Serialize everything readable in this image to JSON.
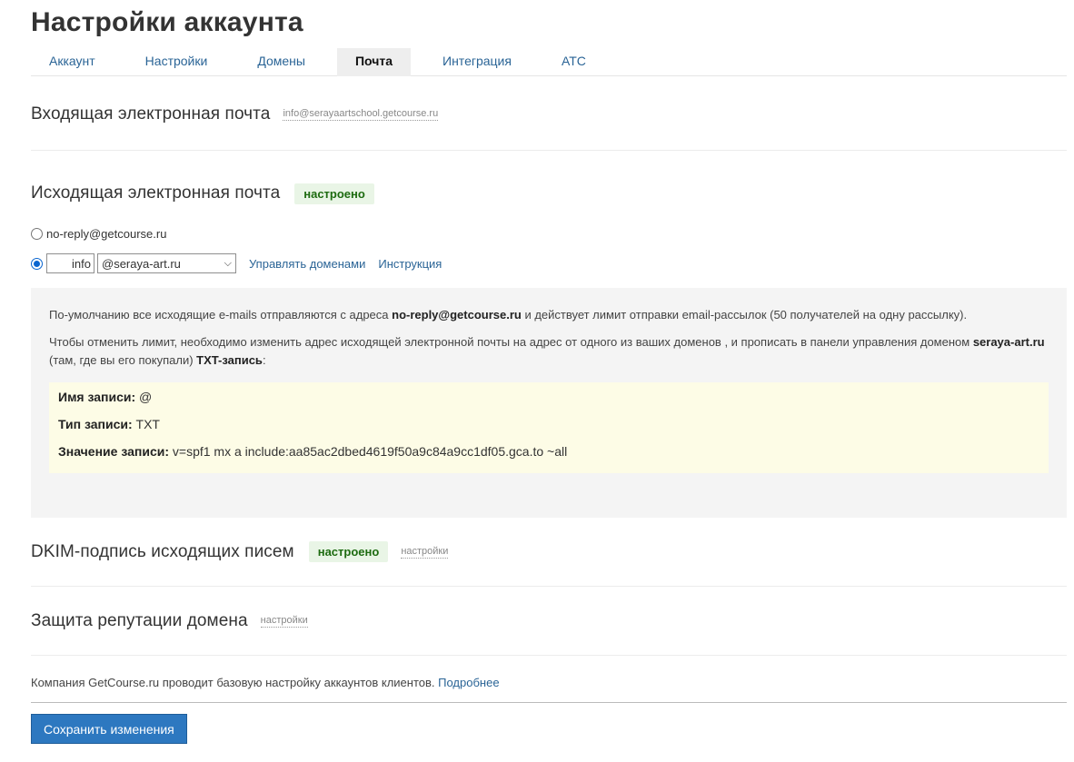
{
  "page": {
    "title": "Настройки аккаунта"
  },
  "tabs": [
    {
      "label": "Аккаунт"
    },
    {
      "label": "Настройки"
    },
    {
      "label": "Домены"
    },
    {
      "label": "Почта",
      "active": true
    },
    {
      "label": "Интеграция"
    },
    {
      "label": "АТС"
    }
  ],
  "incoming": {
    "title": "Входящая электронная почта",
    "address": "info@serayaartschool.getcourse.ru"
  },
  "outgoing": {
    "title": "Исходящая электронная почта",
    "status": "настроено",
    "option_default": "no-reply@getcourse.ru",
    "option_default_selected": false,
    "option_custom_selected": true,
    "local_part": "info",
    "domain_selected": "@seraya-art.ru",
    "manage_domains_link": "Управлять доменами",
    "instruction_link": "Инструкция"
  },
  "info": {
    "p1_a": "По-умолчанию все исходящие e-mails отправляются с адреса ",
    "p1_email": "no-reply@getcourse.ru",
    "p1_b": " и действует лимит отправки email-рассылок (50 получателей на одну рассылку).",
    "p2_a": "Чтобы отменить лимит, необходимо изменить адрес исходящей электронной почты на адрес от одного из ваших доменов   , и прописать в панели управления доменом ",
    "p2_domain": "seraya-art.ru",
    "p2_b": " (там, где вы его покупали) ",
    "p2_txt": "TXT-запись",
    "p2_c": ":",
    "record_name_label": "Имя записи:",
    "record_name_value": "@",
    "record_type_label": "Тип записи:",
    "record_type_value": "TXT",
    "record_value_label": "Значение записи:",
    "record_value_value": "v=spf1 mx a include:aa85ac2dbed4619f50a9c84a9cc1df05.gca.to ~all"
  },
  "dkim": {
    "title": "DKIM-подпись исходящих писем",
    "status": "настроено",
    "settings_link": "настройки"
  },
  "reputation": {
    "title": "Защита репутации домена",
    "settings_link": "настройки"
  },
  "footer": {
    "note": "Компания GetCourse.ru проводит базовую настройку аккаунтов клиентов.",
    "more_link": "Подробнее",
    "save_label": "Сохранить изменения"
  },
  "colors": {
    "link": "#2a6496",
    "badge_bg": "#e9f5e6",
    "badge_text": "#1d6b10",
    "save_button": "#2d78c0",
    "txt_box": "#fdfce6"
  }
}
